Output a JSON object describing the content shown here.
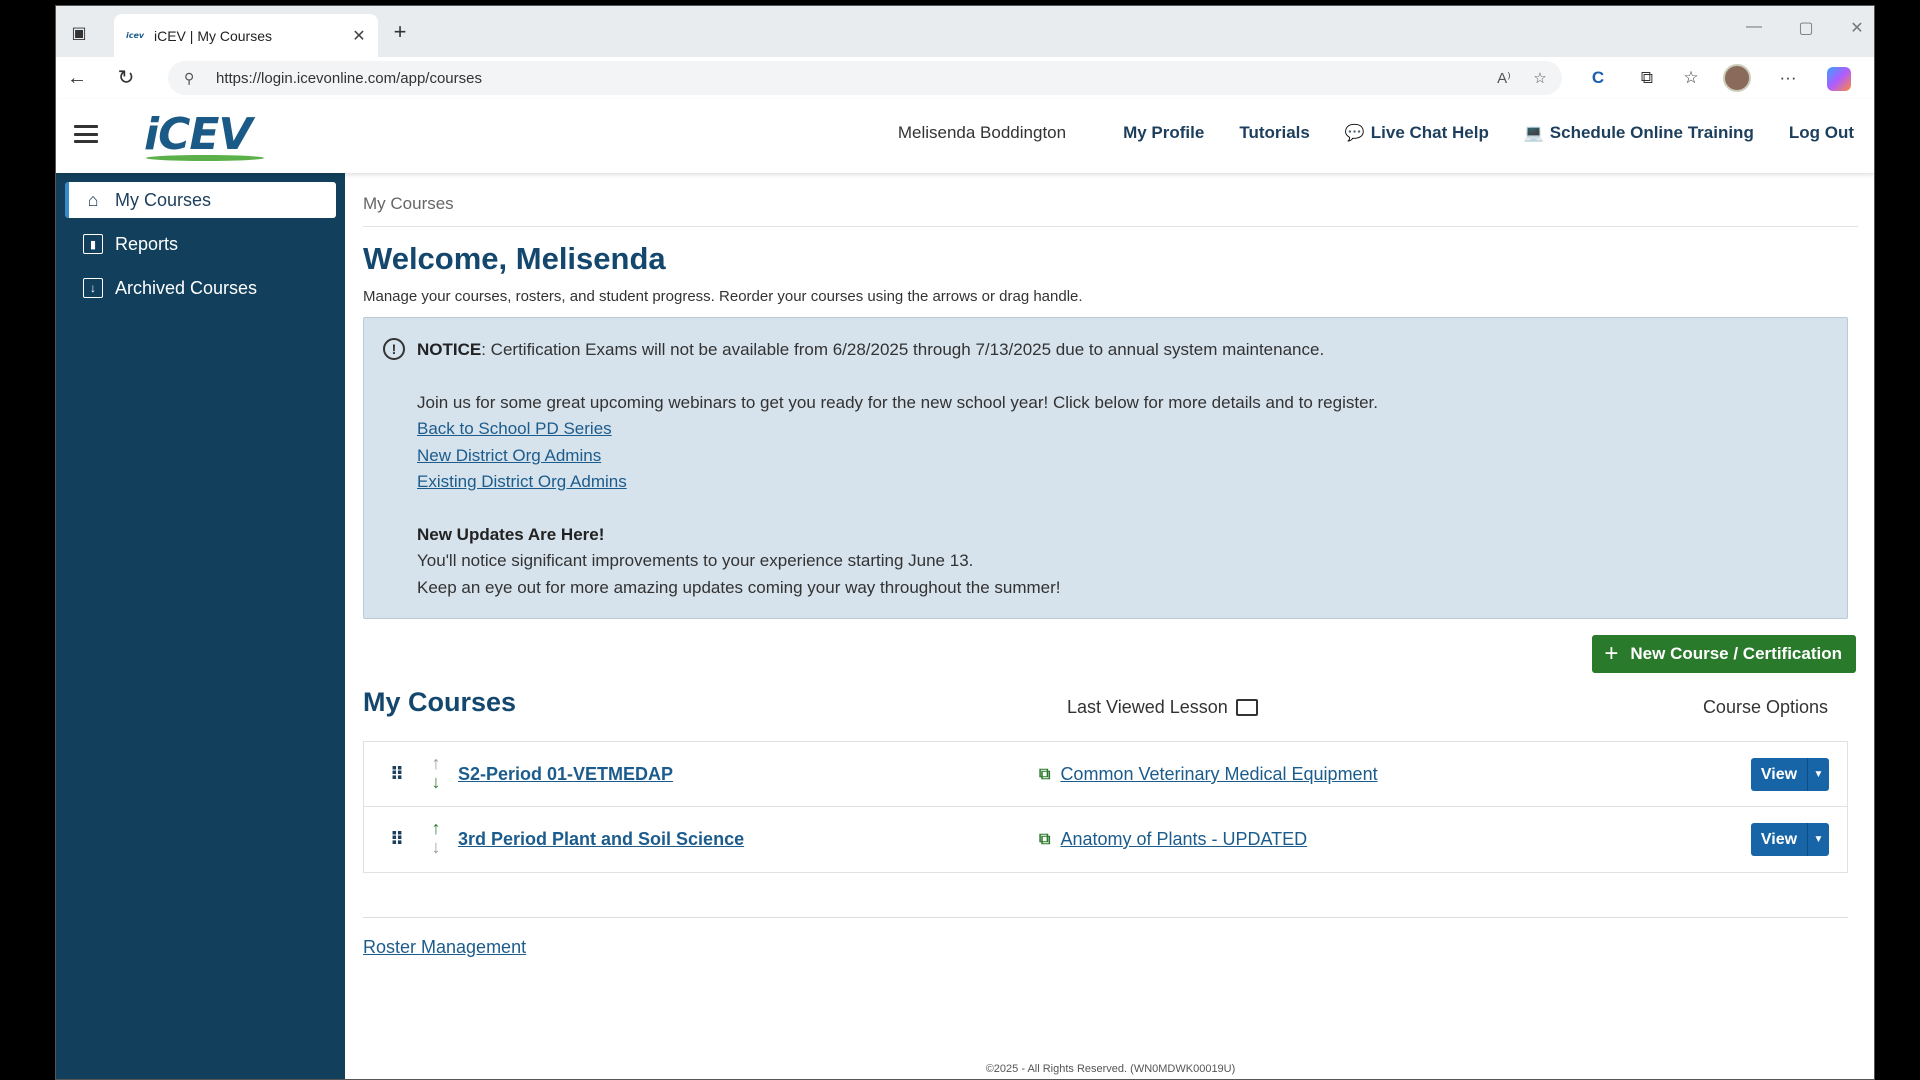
{
  "browser": {
    "tab_title": "iCEV | My Courses",
    "tab_favicon": "icev",
    "url": "https://login.icevonline.com/app/courses",
    "icons": {
      "tabs": "tab-actions-icon",
      "close": "✕",
      "new_tab": "+",
      "back": "←",
      "reload": "↻",
      "lock": "⚲",
      "read_aloud": "A⁾",
      "favorite": "☆",
      "extension_c": "C",
      "extensions": "⧉",
      "favorites": "☆",
      "more": "···",
      "minimize": "—",
      "maximize": "▢",
      "window_close": "✕"
    }
  },
  "header": {
    "logo": "iCEV",
    "user_name": "Melisenda Boddington",
    "nav": {
      "my_profile": "My Profile",
      "tutorials": "Tutorials",
      "live_chat": "Live Chat Help",
      "schedule": "Schedule Online Training",
      "logout": "Log Out"
    }
  },
  "sidebar": {
    "items": [
      {
        "label": "My Courses",
        "icon": "home-icon",
        "active": true
      },
      {
        "label": "Reports",
        "icon": "chart-icon",
        "active": false
      },
      {
        "label": "Archived Courses",
        "icon": "archive-icon",
        "active": false
      }
    ]
  },
  "main": {
    "breadcrumb": "My Courses",
    "welcome": "Welcome, Melisenda",
    "subtitle": "Manage your courses, rosters, and student progress. Reorder your courses using the arrows or drag handle.",
    "notice": {
      "label": "NOTICE",
      "text": ": Certification Exams will not be available from 6/28/2025 through 7/13/2025 due to annual system maintenance.",
      "webinar_intro": "Join us for some great upcoming webinars to get you ready for the new school year! Click below for more details and to register.",
      "links": [
        "Back to School PD Series",
        "New District Org Admins",
        "Existing District Org Admins"
      ],
      "updates_title": "New Updates Are Here!",
      "updates_line1": "You'll notice significant improvements to your experience starting June 13.",
      "updates_line2": "Keep an eye out for more amazing updates coming your way throughout the summer!"
    },
    "new_course_button": "New Course / Certification",
    "courses_title": "My Courses",
    "col_last_viewed": "Last Viewed Lesson",
    "col_options": "Course Options",
    "courses": [
      {
        "name": "S2-Period 01-VETMEDAP",
        "lesson": "Common Veterinary Medical Equipment",
        "view": "View",
        "up_enabled": false,
        "down_enabled": true
      },
      {
        "name": "3rd Period Plant and Soil Science",
        "lesson": "Anatomy of Plants - UPDATED",
        "view": "View",
        "up_enabled": true,
        "down_enabled": false
      }
    ],
    "roster_link": "Roster Management",
    "footer": "©2025 - All Rights Reserved. (WN0MDWK00019U)"
  },
  "colors": {
    "sidebar_bg": "#12405c",
    "primary_text": "#14476d",
    "link": "#1c5c8c",
    "notice_bg": "#d6e2ec",
    "green_button": "#2a7a2c",
    "view_button": "#1765a6"
  }
}
